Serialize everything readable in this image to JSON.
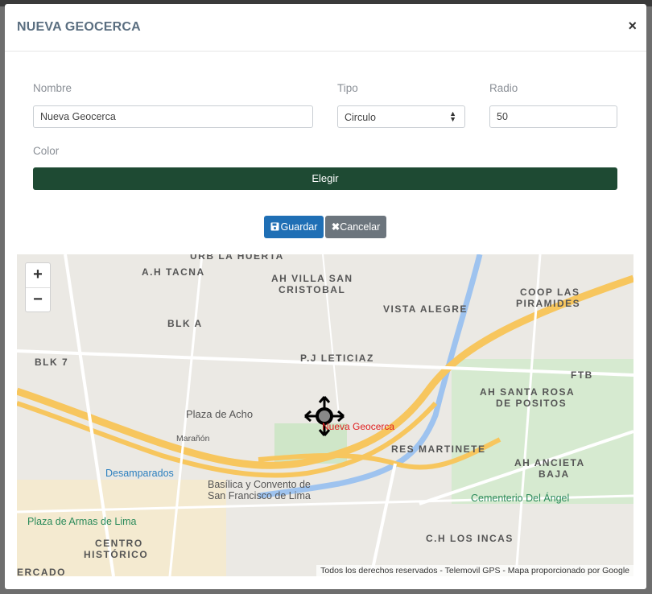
{
  "modal": {
    "title": "NUEVA GEOCERCA",
    "close": "×"
  },
  "form": {
    "nombre_label": "Nombre",
    "nombre_value": "Nueva Geocerca",
    "tipo_label": "Tipo",
    "tipo_value": "Circulo",
    "radio_label": "Radio",
    "radio_value": "50",
    "color_label": "Color",
    "color_button": "Elegir",
    "color_value": "#1e4a33"
  },
  "actions": {
    "save_label": "Guardar",
    "cancel_label": "Cancelar"
  },
  "map": {
    "zoom_in": "+",
    "zoom_out": "−",
    "attribution": "Todos los derechos reservados - Telemovil GPS - Mapa proporcionado por Google",
    "geofence_label": "Nueva Geocerca",
    "labels": {
      "ah_tacna": "A.H TACNA",
      "urb_la_huerta": "URB LA HUERTA",
      "ah_villa_san_cristobal_1": "AH VILLA SAN",
      "ah_villa_san_cristobal_2": "CRISTOBAL",
      "vista_alegre": "VISTA ALEGRE",
      "coop_las_piramides_1": "COOP LAS",
      "coop_las_piramides_2": "PIRAMIDES",
      "blk_a": "BLK A",
      "blk_7": "BLK 7",
      "pj_leticia": "P.J LETICIAZ",
      "ftb": "FTB",
      "ah_santa_rosa_1": "AH SANTA ROSA",
      "ah_santa_rosa_2": "DE POSITOS",
      "res_martinete": "RES MARTINETE",
      "ah_ancieta_1": "AH ANCIETA",
      "ah_ancieta_2": "BAJA",
      "ch_los_incas": "C.H LOS INCAS",
      "centro_historico_1": "CENTRO",
      "centro_historico_2": "HISTÓRICO",
      "mercado": "ERCADO"
    },
    "pois": {
      "plaza_de_acho": "Plaza de Acho",
      "desamparados": "Desamparados",
      "basilica_1": "Basílica y Convento de",
      "basilica_2": "San Francisco de Lima",
      "plaza_de_armas": "Plaza de Armas de Lima",
      "cementerio": "Cementerio Del Ángel",
      "maranon": "Marañón"
    }
  },
  "icons": {
    "close": "close-icon",
    "save": "save-icon",
    "cancel": "x-icon",
    "select": "select-arrows-icon",
    "move": "move-icon"
  }
}
